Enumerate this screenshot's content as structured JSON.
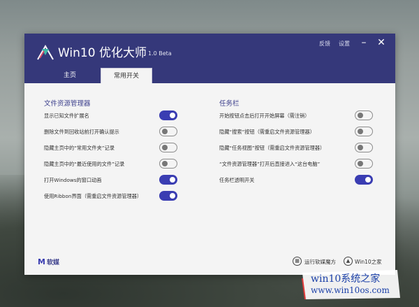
{
  "app": {
    "title": "Win10 优化大师",
    "version": "1.0 Beta"
  },
  "header_links": {
    "feedback": "反馈",
    "settings": "设置"
  },
  "window_buttons": {
    "minimize": "–",
    "close": "✕"
  },
  "tabs": [
    {
      "label": "主页",
      "active": false
    },
    {
      "label": "常用开关",
      "active": true
    }
  ],
  "sections": {
    "explorer": {
      "title": "文件资源管理器",
      "items": [
        {
          "label": "显示已知文件扩展名",
          "on": true
        },
        {
          "label": "删除文件到回收站前打开确认提示",
          "on": false
        },
        {
          "label": "隐藏主页中的“常用文件夹”记录",
          "on": false
        },
        {
          "label": "隐藏主页中的“最近使用的文件”记录",
          "on": false
        },
        {
          "label": "打开Windows的窗口动画",
          "on": true
        },
        {
          "label": "使用Ribbon界面（需重启文件资源管理器）",
          "on": true
        }
      ]
    },
    "taskbar": {
      "title": "任务栏",
      "items": [
        {
          "label": "开始按钮点击后打开开始屏幕（需注销）",
          "on": false
        },
        {
          "label": "隐藏“搜索”按钮（需重启文件资源管理器）",
          "on": false
        },
        {
          "label": "隐藏“任务视图”按钮（需重启文件资源管理器）",
          "on": false
        },
        {
          "label": "“文件资源管理器”打开后直接进入“这台电脑”",
          "on": false
        },
        {
          "label": "任务栏透明开关",
          "on": true
        }
      ]
    }
  },
  "footer": {
    "brand_mark": "M",
    "brand": "软媒",
    "run_link": "运行软媒魔方",
    "home_link": "Win10之家"
  },
  "watermark": {
    "line1": "win10系统之家",
    "line2": "www.win10os.com"
  },
  "colors": {
    "header": "#35387a",
    "toggle_on": "#3a3db2",
    "accent_text": "#3c3f8c"
  }
}
